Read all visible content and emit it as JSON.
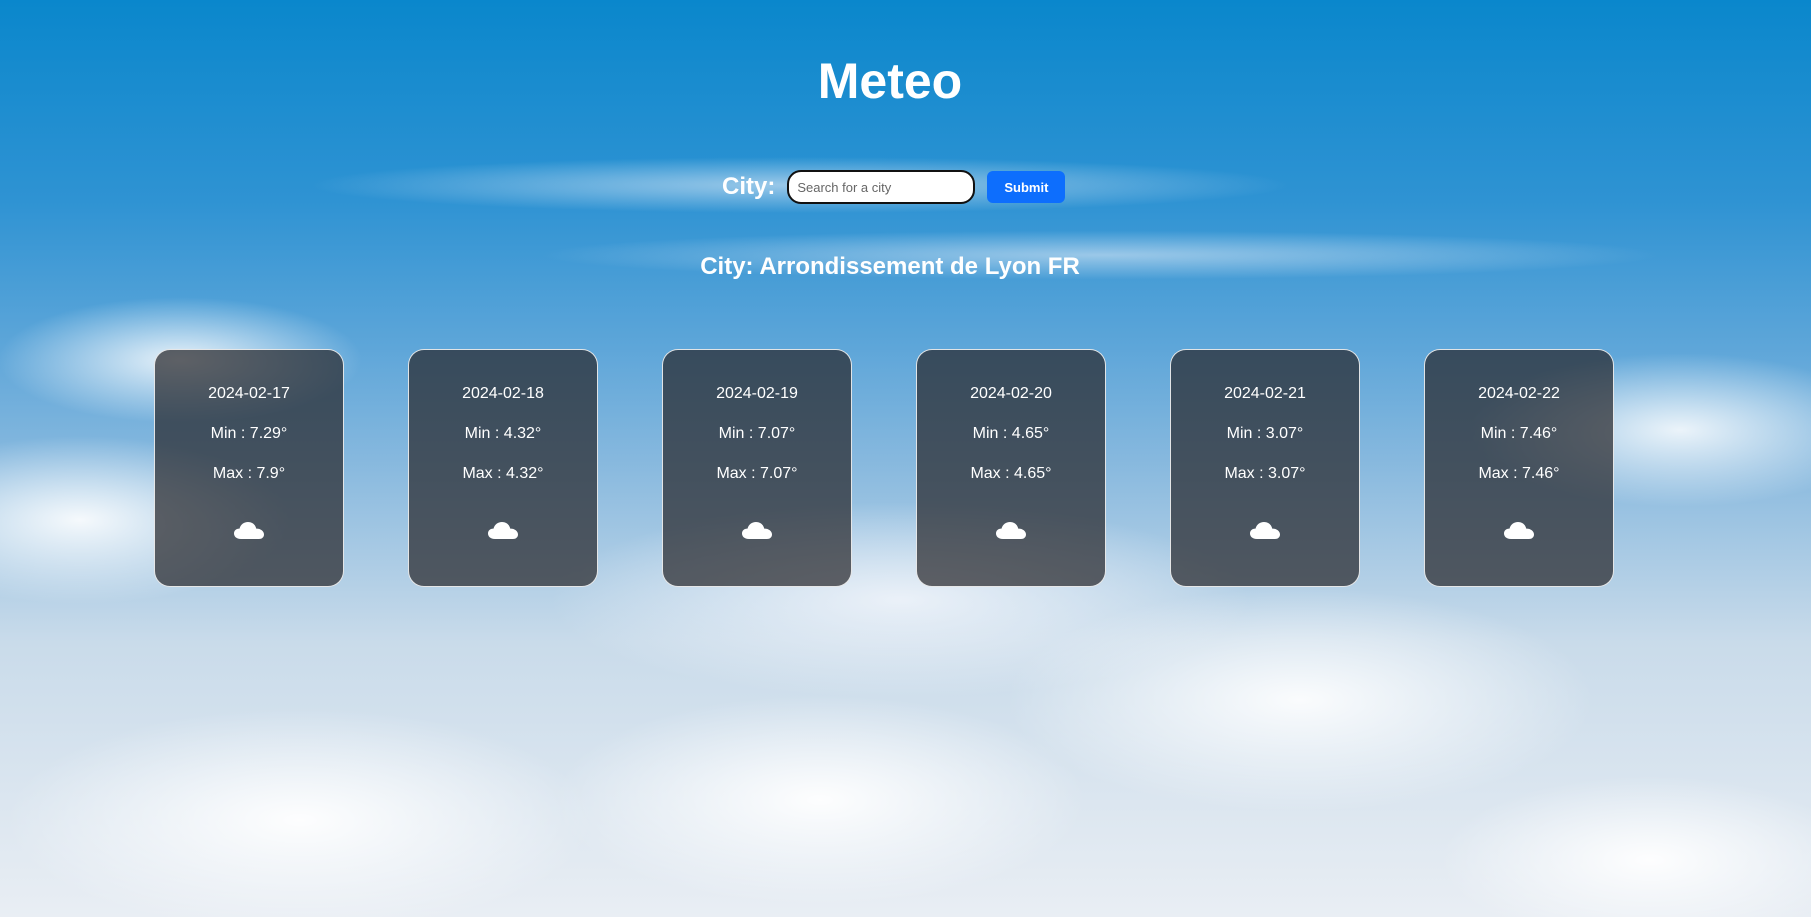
{
  "header": {
    "title": "Meteo"
  },
  "search": {
    "label": "City:",
    "placeholder": "Search for a city",
    "value": "",
    "submit_label": "Submit"
  },
  "result": {
    "city_text": "City: Arrondissement de Lyon FR"
  },
  "forecast": [
    {
      "date": "2024-02-17",
      "min": "Min : 7.29°",
      "max": "Max : 7.9°",
      "icon": "cloud-icon"
    },
    {
      "date": "2024-02-18",
      "min": "Min : 4.32°",
      "max": "Max : 4.32°",
      "icon": "cloud-icon"
    },
    {
      "date": "2024-02-19",
      "min": "Min : 7.07°",
      "max": "Max : 7.07°",
      "icon": "cloud-icon"
    },
    {
      "date": "2024-02-20",
      "min": "Min : 4.65°",
      "max": "Max : 4.65°",
      "icon": "cloud-icon"
    },
    {
      "date": "2024-02-21",
      "min": "Min : 3.07°",
      "max": "Max : 3.07°",
      "icon": "cloud-icon"
    },
    {
      "date": "2024-02-22",
      "min": "Min : 7.46°",
      "max": "Max : 7.46°",
      "icon": "cloud-icon"
    }
  ],
  "colors": {
    "submit_button": "#0d6efd",
    "sky_top": "#0a87cc",
    "card_background": "#28282c"
  }
}
